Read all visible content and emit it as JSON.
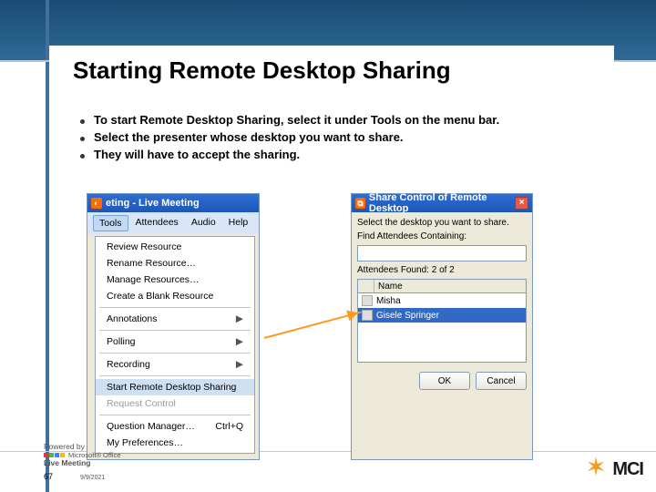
{
  "slide": {
    "title": "Starting Remote Desktop Sharing",
    "bullets": [
      "To start Remote Desktop Sharing, select it under Tools on the menu bar.",
      "Select the presenter whose desktop you want to share.",
      "They will have to accept the sharing."
    ],
    "page_number": "67",
    "date": "9/9/2021"
  },
  "powered": {
    "label": "Powered by",
    "prefix": "Microsoft® Office",
    "product": "Live Meeting"
  },
  "brand": {
    "name": "MCI"
  },
  "tools_window": {
    "title": "eting - Live Meeting",
    "menubar": {
      "tools": "Tools",
      "attendees": "Attendees",
      "audio": "Audio",
      "help": "Help"
    },
    "menu": {
      "review": "Review Resource",
      "rename": "Rename Resource…",
      "manage": "Manage Resources…",
      "create_blank": "Create a Blank Resource",
      "annotations": "Annotations",
      "polling": "Polling",
      "recording": "Recording",
      "start_rds": "Start Remote Desktop Sharing",
      "request": "Request Control",
      "qmanager": "Question Manager…",
      "qmanager_shortcut": "Ctrl+Q",
      "prefs": "My Preferences…"
    }
  },
  "share_dialog": {
    "title": "Share Control of Remote Desktop",
    "instruction": "Select the desktop you want to share.",
    "find_label": "Find Attendees Containing:",
    "found_label": "Attendees Found: 2 of 2",
    "col_name": "Name",
    "attendees": {
      "a1": "Misha",
      "a2": "Gisele Springer"
    },
    "ok": "OK",
    "cancel": "Cancel"
  }
}
